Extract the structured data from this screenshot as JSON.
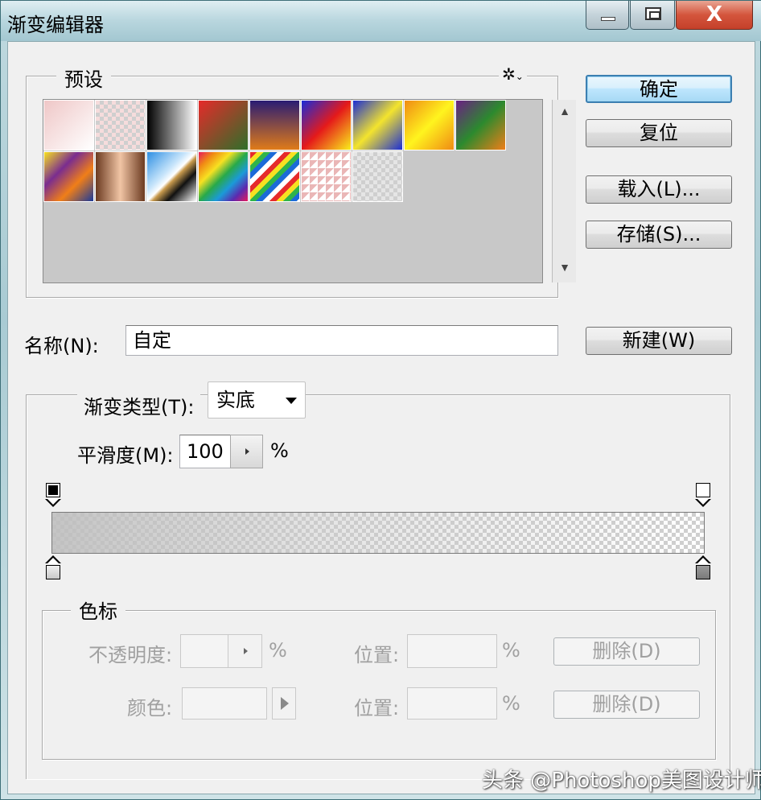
{
  "window": {
    "title": "渐变编辑器",
    "close_glyph": "X"
  },
  "presets": {
    "legend": "预设",
    "gear_glyph": "✲",
    "menu_caret": "⌄",
    "swatches": [
      {
        "name": "foreground-to-transparent-pink",
        "css": "linear-gradient(135deg,#efc7c7 0%,#fff 100%)"
      },
      {
        "name": "transparent-checker-pink",
        "css": "checker-pink"
      },
      {
        "name": "black-to-white",
        "css": "linear-gradient(90deg,#000 0%,#fff 100%)"
      },
      {
        "name": "red-to-green",
        "css": "linear-gradient(135deg,#e62a2a 0%,#2e6f2a 100%)"
      },
      {
        "name": "violet-to-orange",
        "css": "linear-gradient(180deg,#2a1c74 0%,#e07b19 100%)"
      },
      {
        "name": "blue-red-yellow",
        "css": "linear-gradient(135deg,#1a2bd8 0%,#e51a1a 50%,#f9ef1c 100%)"
      },
      {
        "name": "blue-yellow-blue",
        "css": "linear-gradient(135deg,#1c2ed4 0%,#f3e42d 50%,#1c2ed4 100%)"
      },
      {
        "name": "orange-yellow-orange",
        "css": "linear-gradient(135deg,#f08b14 0%,#fff41e 50%,#f08b14 100%)"
      },
      {
        "name": "violet-green-orange",
        "css": "linear-gradient(135deg,#6b1f84 0%,#2c8a2e 50%,#f07e18 100%)"
      },
      {
        "name": "yellow-violet-orange-blue",
        "css": "linear-gradient(135deg,#f7e121 0%,#7a2d8f 35%,#f07e18 65%,#1b3a9a 100%)"
      },
      {
        "name": "copper",
        "css": "linear-gradient(90deg,#6b3a20 0%,#f1c5a5 50%,#6b3a20 100%)"
      },
      {
        "name": "chrome",
        "css": "linear-gradient(135deg,#2e8fe3 0%,#c9e6fb 40%,#fff 50%,#c89a4d 55%,#111 70%,#fff 100%)"
      },
      {
        "name": "spectrum",
        "css": "linear-gradient(135deg,#e6195b,#f08b14,#f7e121,#28a94a,#1b9ad8,#5b2ab0,#e6195b)"
      },
      {
        "name": "transparent-rainbow",
        "css": "repeating-linear-gradient(135deg,#e62a2a 0 6px,#f7e121 6px 12px,#2fb44a 12px 18px,#1b6ad8 18px 24px,#fff 24px 30px)"
      },
      {
        "name": "transparent-stripes",
        "css": "checker-stripes"
      },
      {
        "name": "neutral-density",
        "css": "checker-gray"
      }
    ]
  },
  "buttons": {
    "ok": "确定",
    "reset": "复位",
    "load": "载入(L)...",
    "save": "存储(S)...",
    "new": "新建(W)"
  },
  "name_field": {
    "label": "名称(N):",
    "value": "自定"
  },
  "gradient_type": {
    "label": "渐变类型(T):",
    "selected": "实底"
  },
  "smoothness": {
    "label": "平滑度(M):",
    "value": "100",
    "unit": "%"
  },
  "stops": {
    "legend": "色标",
    "opacity_label": "不透明度:",
    "opacity_value": "",
    "opacity_unit": "%",
    "opacity_location_label": "位置:",
    "opacity_location_value": "",
    "opacity_location_unit": "%",
    "delete_label_1": "删除(D)",
    "color_label": "颜色:",
    "color_location_label": "位置:",
    "color_location_value": "",
    "color_location_unit": "%",
    "delete_label_2": "删除(D)"
  },
  "watermark": "头条 @Photoshop美图设计师",
  "colors": {
    "accent": "#3c7fb1",
    "stop_left": "#000000",
    "stop_right": "#ffffff"
  }
}
